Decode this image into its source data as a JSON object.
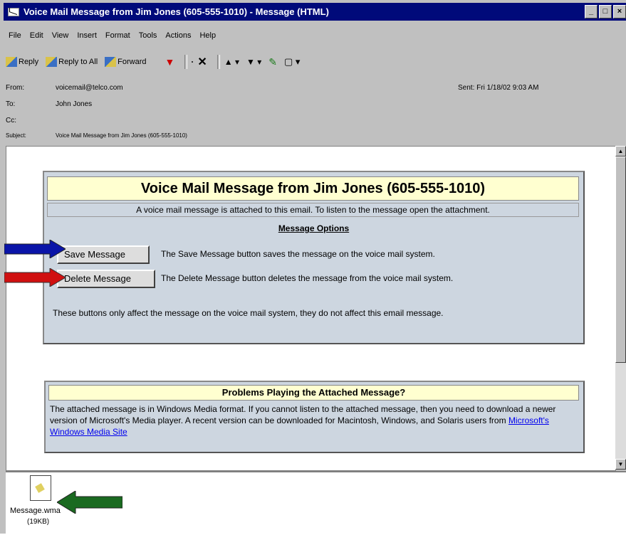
{
  "window": {
    "title": "Voice Mail Message from Jim Jones (605-555-1010) - Message (HTML)"
  },
  "menu": [
    "File",
    "Edit",
    "View",
    "Insert",
    "Format",
    "Tools",
    "Actions",
    "Help"
  ],
  "toolbar": {
    "reply": "Reply",
    "reply_all": "Reply to All",
    "forward": "Forward"
  },
  "header": {
    "from_label": "From:",
    "from": "voicemail@telco.com",
    "to_label": "To:",
    "to": "John Jones",
    "cc_label": "Cc:",
    "subject_label": "Subject:",
    "subject": "Voice Mail Message from Jim Jones (605-555-1010)",
    "sent_label": "Sent:",
    "sent": "Fri 1/18/02 9:03 AM"
  },
  "message": {
    "title": "Voice Mail Message from Jim Jones (605-555-1010)",
    "subtitle": "A voice mail message is attached to this email. To listen to the message open the attachment.",
    "options_heading": "Message Options",
    "save_button": "Save Message",
    "save_desc": "The Save Message button saves the message on the voice mail system.",
    "delete_button": "Delete Message",
    "delete_desc": "The Delete Message button deletes the message from the voice mail system.",
    "note": "These buttons only affect the message on the voice mail system, they do not affect this email message."
  },
  "problems": {
    "title": "Problems Playing the Attached Message?",
    "body": "The attached message is in Windows Media format. If you cannot listen to the attached message, then you need to download a newer version of Microsoft's Media player. A recent version can be downloaded for Macintosh, Windows, and Solaris users from ",
    "link": "Microsoft's Windows Media Site"
  },
  "attachment": {
    "name": "Message.wma",
    "size": "(19KB)"
  },
  "colors": {
    "blue_arrow": "#0a14a8",
    "red_arrow": "#d01010",
    "green_arrow": "#1a6a20",
    "title_bar": "#000a7a"
  }
}
